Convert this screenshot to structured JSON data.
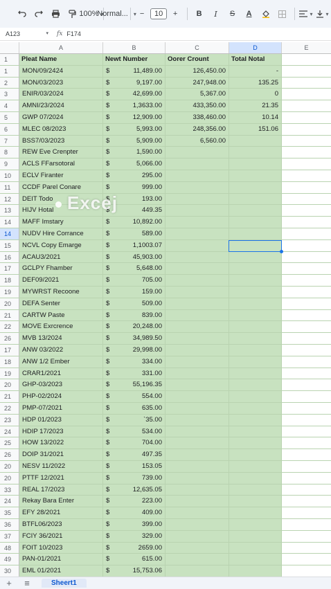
{
  "toolbar": {
    "zoom": "100%",
    "style": "Normal...",
    "font_size": "10",
    "undo_icon": "undo-icon",
    "redo_icon": "redo-icon",
    "print_icon": "print-icon",
    "paint_format_icon": "paint-format-icon"
  },
  "formula_bar": {
    "cell_ref": "A123",
    "fx": "fx",
    "value": "F174"
  },
  "columns": [
    "A",
    "B",
    "C",
    "D",
    "E"
  ],
  "header_row": {
    "num": "1",
    "a": "Pleat Name",
    "b": "Newt Number",
    "c": "Oorer Crount",
    "d": "Total Notal"
  },
  "rows": [
    {
      "num": "1",
      "a": "MON/09/2424",
      "b": "11,489.00",
      "c": "126,450.00",
      "d": "-"
    },
    {
      "num": "2",
      "a": "MON/03/2023",
      "b": "9,197.00",
      "c": "247,948.00",
      "d": "135.25"
    },
    {
      "num": "3",
      "a": "ENIR/03/2024",
      "b": "42,699.00",
      "c": "5,367.00",
      "d": "0"
    },
    {
      "num": "4",
      "a": "AMNI/23/2024",
      "b": "1,3633.00",
      "c": "433,350.00",
      "d": "21.35"
    },
    {
      "num": "5",
      "a": "GWP 07/2024",
      "b": "12,909.00",
      "c": "338,460.00",
      "d": "10.14"
    },
    {
      "num": "6",
      "a": "MLEC 08/2023",
      "b": "5,993.00",
      "c": "248,356.00",
      "d": "151.06"
    },
    {
      "num": "7",
      "a": "BSS7/03/2023",
      "b": "5,909.00",
      "c": "6,560.00",
      "d": ""
    },
    {
      "num": "8",
      "a": "REW Eve Crenpter",
      "b": "1,590.00",
      "c": "",
      "d": ""
    },
    {
      "num": "9",
      "a": "ACLS FFarsotoral",
      "b": "5,066.00",
      "c": "",
      "d": ""
    },
    {
      "num": "10",
      "a": "ECLV Firanter",
      "b": "295.00",
      "c": "",
      "d": ""
    },
    {
      "num": "11",
      "a": "CCDF Parel Conare",
      "b": "999.00",
      "c": "",
      "d": ""
    },
    {
      "num": "12",
      "a": "DEIT Todo",
      "b": "193.00",
      "c": "",
      "d": ""
    },
    {
      "num": "13",
      "a": "HIJV Hotal",
      "b": "449.35",
      "c": "",
      "d": ""
    },
    {
      "num": "14",
      "a": "MAFF Imstary",
      "b": "10,892.00",
      "c": "",
      "d": ""
    },
    {
      "num": "14",
      "a": "NUDV Hire Corrance",
      "b": "589.00",
      "c": "",
      "d": ""
    },
    {
      "num": "15",
      "a": "NCVL Copy Emarge",
      "b": "1,1003.07",
      "c": "",
      "d": ""
    },
    {
      "num": "16",
      "a": "ACAU3/2021",
      "b": "45,903.00",
      "c": "",
      "d": ""
    },
    {
      "num": "17",
      "a": "GCLPY Fhamber",
      "b": "5,648.00",
      "c": "",
      "d": ""
    },
    {
      "num": "18",
      "a": "DEF09/2021",
      "b": "705.00",
      "c": "",
      "d": ""
    },
    {
      "num": "19",
      "a": "MYWRST Recoone",
      "b": "159.00",
      "c": "",
      "d": ""
    },
    {
      "num": "20",
      "a": "DEFA Senter",
      "b": "509.00",
      "c": "",
      "d": ""
    },
    {
      "num": "21",
      "a": "CARTW Paste",
      "b": "839.00",
      "c": "",
      "d": ""
    },
    {
      "num": "22",
      "a": "MOVE Exrcrence",
      "b": "20,248.00",
      "c": "",
      "d": ""
    },
    {
      "num": "26",
      "a": "MVB 13/2024",
      "b": "34,989.50",
      "c": "",
      "d": ""
    },
    {
      "num": "17",
      "a": "ANW 03/2022",
      "b": "29,998.00",
      "c": "",
      "d": ""
    },
    {
      "num": "18",
      "a": "ANW 1/2 Ember",
      "b": "334.00",
      "c": "",
      "d": ""
    },
    {
      "num": "19",
      "a": "CRAR1/2021",
      "b": "331.00",
      "c": "",
      "d": ""
    },
    {
      "num": "20",
      "a": "GHP-03/2023",
      "b": "55,196.35",
      "c": "",
      "d": ""
    },
    {
      "num": "21",
      "a": "PHP-02/2024",
      "b": "554.00",
      "c": "",
      "d": ""
    },
    {
      "num": "22",
      "a": "PMP-07/2021",
      "b": "635.00",
      "c": "",
      "d": ""
    },
    {
      "num": "23",
      "a": "HDP 01/2023",
      "b": "`35.00",
      "c": "",
      "d": ""
    },
    {
      "num": "24",
      "a": "HDIP 17/2023",
      "b": "534.00",
      "c": "",
      "d": ""
    },
    {
      "num": "25",
      "a": "HOW 13/2022",
      "b": "704.00",
      "c": "",
      "d": ""
    },
    {
      "num": "26",
      "a": "DOIP 31/2021",
      "b": "497.35",
      "c": "",
      "d": ""
    },
    {
      "num": "20",
      "a": "NESV 11/2022",
      "b": "153.05",
      "c": "",
      "d": ""
    },
    {
      "num": "20",
      "a": "PTTF 12/2021",
      "b": "739.00",
      "c": "",
      "d": ""
    },
    {
      "num": "33",
      "a": "REAL 17/2023",
      "b": "12,635.05",
      "c": "",
      "d": ""
    },
    {
      "num": "24",
      "a": "Rekay Bara Enter",
      "b": "223.00",
      "c": "",
      "d": ""
    },
    {
      "num": "35",
      "a": "EFY 28/2021",
      "b": "409.00",
      "c": "",
      "d": ""
    },
    {
      "num": "36",
      "a": "BTFL06/2023",
      "b": "399.00",
      "c": "",
      "d": ""
    },
    {
      "num": "37",
      "a": "FCIY 36/2021",
      "b": "329.00",
      "c": "",
      "d": ""
    },
    {
      "num": "48",
      "a": "FOIT 10/2023",
      "b": "2659.00",
      "c": "",
      "d": ""
    },
    {
      "num": "49",
      "a": "PAN-01/2021",
      "b": "615.00",
      "c": "",
      "d": ""
    },
    {
      "num": "30",
      "a": "EML 01/2021",
      "b": "15,753.06",
      "c": "",
      "d": ""
    }
  ],
  "currency_symbol": "$",
  "watermark": "Excej",
  "sheet_tab": "Sheert1",
  "colors": {
    "cell_fill": "#c8e2c0",
    "selection": "#1a73e8"
  }
}
